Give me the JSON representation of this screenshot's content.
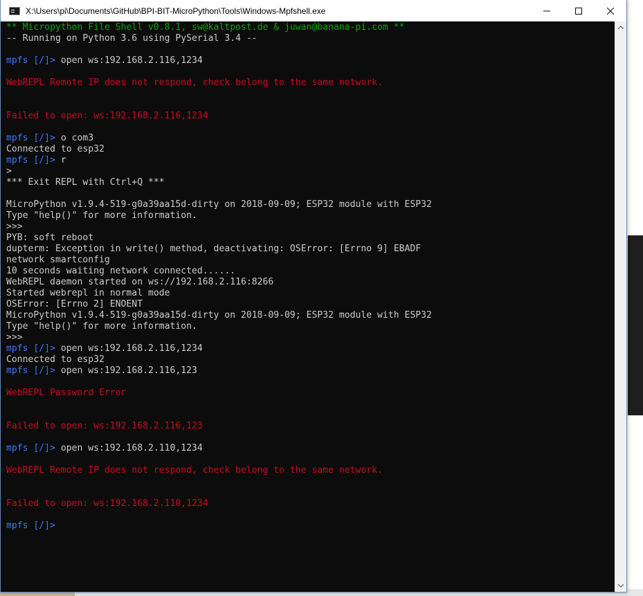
{
  "window": {
    "title": "X:\\Users\\pi\\Documents\\GitHub\\BPI-BIT-MicroPython\\Tools\\Windows-Mpfshell.exe",
    "minimize_glyph": "—",
    "maximize_glyph": "☐",
    "close_glyph": "✕"
  },
  "console": {
    "lines": [
      [
        {
          "t": "** Micropython File Shell v0.8.1, sw@kaltpost.de & juwan@banana-pi.com **",
          "c": "green"
        }
      ],
      [
        {
          "t": "-- Running on Python 3.6 using PySerial 3.4 --",
          "c": "white"
        }
      ],
      [],
      [
        {
          "t": "mpfs [/]> ",
          "c": "blue"
        },
        {
          "t": "open ws:192.168.2.116,1234",
          "c": "white"
        }
      ],
      [],
      [
        {
          "t": "WebREPL Remote IP does not respond, check belong to the same network.",
          "c": "red"
        }
      ],
      [],
      [],
      [
        {
          "t": "Failed to open: ws:192.168.2.116,1234",
          "c": "red"
        }
      ],
      [],
      [
        {
          "t": "mpfs [/]> ",
          "c": "blue"
        },
        {
          "t": "o com3",
          "c": "white"
        }
      ],
      [
        {
          "t": "Connected to esp32",
          "c": "white"
        }
      ],
      [
        {
          "t": "mpfs [/]> ",
          "c": "blue"
        },
        {
          "t": "r",
          "c": "white"
        }
      ],
      [
        {
          "t": ">",
          "c": "white"
        }
      ],
      [
        {
          "t": "*** Exit REPL with Ctrl+Q ***",
          "c": "white"
        }
      ],
      [],
      [
        {
          "t": "MicroPython v1.9.4-519-g0a39aa15d-dirty on 2018-09-09; ESP32 module with ESP32",
          "c": "white"
        }
      ],
      [
        {
          "t": "Type \"help()\" for more information.",
          "c": "white"
        }
      ],
      [
        {
          "t": ">>>",
          "c": "white"
        }
      ],
      [
        {
          "t": "PYB: soft reboot",
          "c": "white"
        }
      ],
      [
        {
          "t": "dupterm: Exception in write() method, deactivating: OSError: [Errno 9] EBADF",
          "c": "white"
        }
      ],
      [
        {
          "t": "network smartconfig",
          "c": "white"
        }
      ],
      [
        {
          "t": "10 seconds waiting network connected......",
          "c": "white"
        }
      ],
      [
        {
          "t": "WebREPL daemon started on ws://192.168.2.116:8266",
          "c": "white"
        }
      ],
      [
        {
          "t": "Started webrepl in normal mode",
          "c": "white"
        }
      ],
      [
        {
          "t": "OSError: [Errno 2] ENOENT",
          "c": "white"
        }
      ],
      [
        {
          "t": "MicroPython v1.9.4-519-g0a39aa15d-dirty on 2018-09-09; ESP32 module with ESP32",
          "c": "white"
        }
      ],
      [
        {
          "t": "Type \"help()\" for more information.",
          "c": "white"
        }
      ],
      [
        {
          "t": ">>>",
          "c": "white"
        }
      ],
      [
        {
          "t": "mpfs [/]> ",
          "c": "blue"
        },
        {
          "t": "open ws:192.168.2.116,1234",
          "c": "white"
        }
      ],
      [
        {
          "t": "Connected to esp32",
          "c": "white"
        }
      ],
      [
        {
          "t": "mpfs [/]> ",
          "c": "blue"
        },
        {
          "t": "open ws:192.168.2.116,123",
          "c": "white"
        }
      ],
      [],
      [
        {
          "t": "WebREPL Password Error",
          "c": "red"
        }
      ],
      [],
      [],
      [
        {
          "t": "Failed to open: ws:192.168.2.116,123",
          "c": "red"
        }
      ],
      [],
      [
        {
          "t": "mpfs [/]> ",
          "c": "blue"
        },
        {
          "t": "open ws:192.168.2.110,1234",
          "c": "white"
        }
      ],
      [],
      [
        {
          "t": "WebREPL Remote IP does not respond, check belong to the same network.",
          "c": "red"
        }
      ],
      [],
      [],
      [
        {
          "t": "Failed to open: ws:192.168.2.110,1234",
          "c": "red"
        }
      ],
      [],
      [
        {
          "t": "mpfs [/]> ",
          "c": "blue"
        }
      ]
    ]
  },
  "colors": {
    "green": "#13a10e",
    "white": "#cccccc",
    "red": "#c50f1f",
    "blue": "#3b78ff",
    "console_bg": "#0c0c0c"
  },
  "icons": {
    "app": "console-app-icon",
    "scroll_up": "chevron-up-icon",
    "scroll_down": "chevron-down-icon"
  }
}
